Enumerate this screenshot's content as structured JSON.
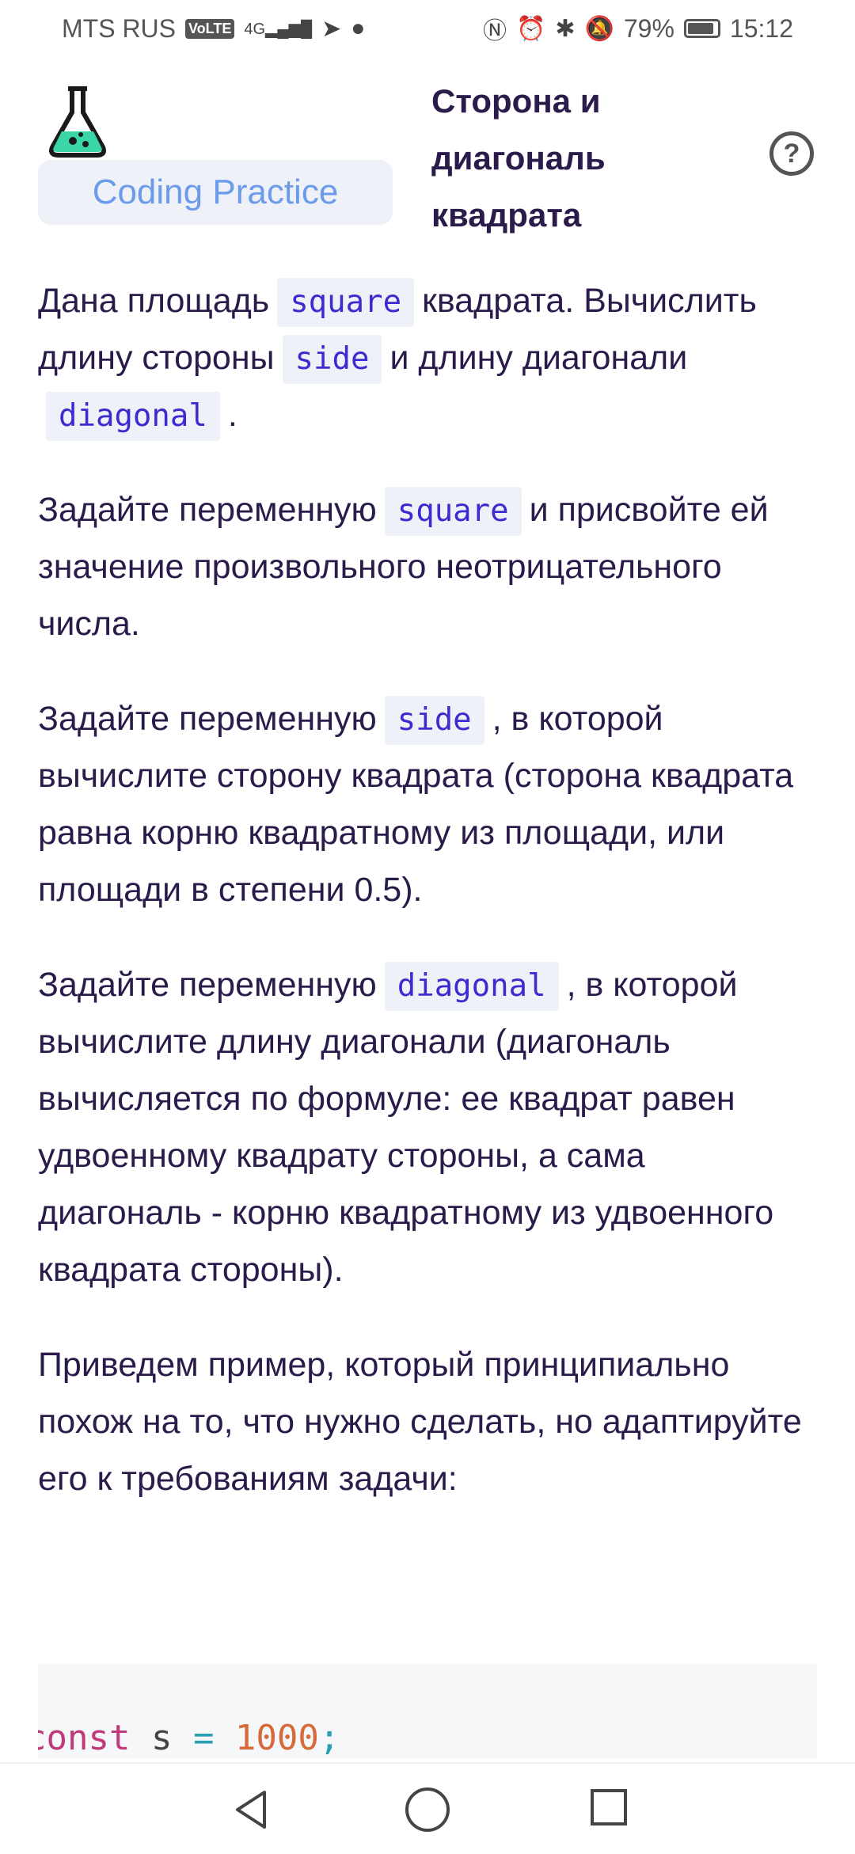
{
  "status_bar": {
    "carrier": "MTS RUS",
    "volte": "VoLTE",
    "network": "4G",
    "battery_pct": "79%",
    "time": "15:12",
    "icons": [
      "volte-icon",
      "signal-icon",
      "telegram-icon",
      "chat-icon",
      "nfc-icon",
      "alarm-icon",
      "bluetooth-icon",
      "mute-icon",
      "battery-icon"
    ]
  },
  "header": {
    "brand": "Coding Practice",
    "title": "Сторона и диагональ квадрата",
    "help": "?",
    "logo_color": "#3ad6a7"
  },
  "content": {
    "p1": {
      "a": "Дана площадь",
      "c1": "square",
      "b": "квадрата. Вычислить длину стороны",
      "c2": "side",
      "c": "и длину диагонали",
      "c3": "diagonal",
      "d": "."
    },
    "p2": {
      "a": "Задайте переменную",
      "c1": "square",
      "b": "и присвойте ей значение произвольного неотрицательного числа."
    },
    "p3": {
      "a": "Задайте переменную",
      "c1": "side",
      "b": ", в которой вычислите сторону квадрата (сторона квадрата равна корню квадратному из площади, или площади в степени 0.5)."
    },
    "p4": {
      "a": "Задайте переменную",
      "c1": "diagonal",
      "b": ", в которой вычислите длину диагонали (диагональ вычисляется по формуле: ее квадрат равен удвоенному квадрату стороны, а сама диагональ - корню квадратному из удвоенного квадрата стороны)."
    },
    "p5": "Приведем пример, который принципиально похож на то, что нужно сделать, но адаптируйте его к требованиям задачи:"
  },
  "code": {
    "kw": "const",
    "id": " s ",
    "op": "=",
    "num": " 1000",
    "semi": ";"
  },
  "accent": {
    "code_text": "#3b2bd0",
    "code_bg": "#eef2f8",
    "brand_text": "#6b9bea"
  }
}
